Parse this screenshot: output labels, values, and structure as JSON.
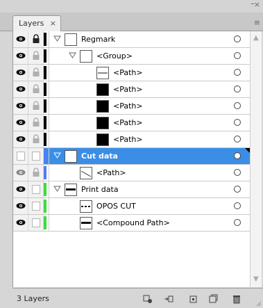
{
  "panel": {
    "tab_label": "Layers",
    "tab_close": "×",
    "collapse": "×",
    "minimize": "–",
    "menu_icon": "≡"
  },
  "rows": [
    {
      "label": "Regmark",
      "kind": "layer",
      "expanded": true,
      "indent": 0,
      "thumb": "white",
      "color": "#000000",
      "lock": true,
      "visible": true,
      "selected": false
    },
    {
      "label": "<Group>",
      "kind": "group",
      "expanded": true,
      "indent": 1,
      "thumb": "white",
      "color": "#000000",
      "lock": true,
      "visible": true,
      "selected": false
    },
    {
      "label": "<Path>",
      "kind": "path",
      "indent": 2,
      "thumb": "white",
      "color": "#000000",
      "lock": true,
      "visible": true,
      "selected": false
    },
    {
      "label": "<Path>",
      "kind": "path",
      "indent": 2,
      "thumb": "black",
      "color": "#000000",
      "lock": true,
      "visible": true,
      "selected": false
    },
    {
      "label": "<Path>",
      "kind": "path",
      "indent": 2,
      "thumb": "black",
      "color": "#000000",
      "lock": true,
      "visible": true,
      "selected": false
    },
    {
      "label": "<Path>",
      "kind": "path",
      "indent": 2,
      "thumb": "black",
      "color": "#000000",
      "lock": true,
      "visible": true,
      "selected": false
    },
    {
      "label": "<Path>",
      "kind": "path",
      "indent": 2,
      "thumb": "black",
      "color": "#000000",
      "lock": true,
      "visible": true,
      "selected": false
    },
    {
      "label": "Cut data",
      "kind": "layer",
      "expanded": true,
      "indent": 0,
      "thumb": "white",
      "color": "#4f7bff",
      "lock": false,
      "visible": false,
      "selected": true
    },
    {
      "label": "<Path>",
      "kind": "path",
      "indent": 1,
      "thumb": "line",
      "color": "#4f7bff",
      "lock": true,
      "visible": true,
      "dim": true,
      "selected": false
    },
    {
      "label": "Print data",
      "kind": "layer",
      "expanded": true,
      "indent": 0,
      "thumb": "bar",
      "color": "#3ddc3d",
      "lock": false,
      "visible": true,
      "selected": false
    },
    {
      "label": "OPOS CUT",
      "kind": "path",
      "indent": 1,
      "thumb": "dash",
      "color": "#3ddc3d",
      "lock": false,
      "visible": true,
      "selected": false
    },
    {
      "label": "<Compound Path>",
      "kind": "path",
      "indent": 1,
      "thumb": "bar",
      "color": "#3ddc3d",
      "lock": false,
      "visible": true,
      "selected": false
    }
  ],
  "footer": {
    "count_label": "3 Layers",
    "icons": [
      "locate-object-icon",
      "make-clipping-mask-icon",
      "new-sublayer-icon",
      "new-layer-icon",
      "delete-icon"
    ]
  },
  "colors": {
    "selection": "#3a8ee6",
    "regmark": "#000000",
    "cut": "#4f7bff",
    "print": "#3ddc3d"
  }
}
